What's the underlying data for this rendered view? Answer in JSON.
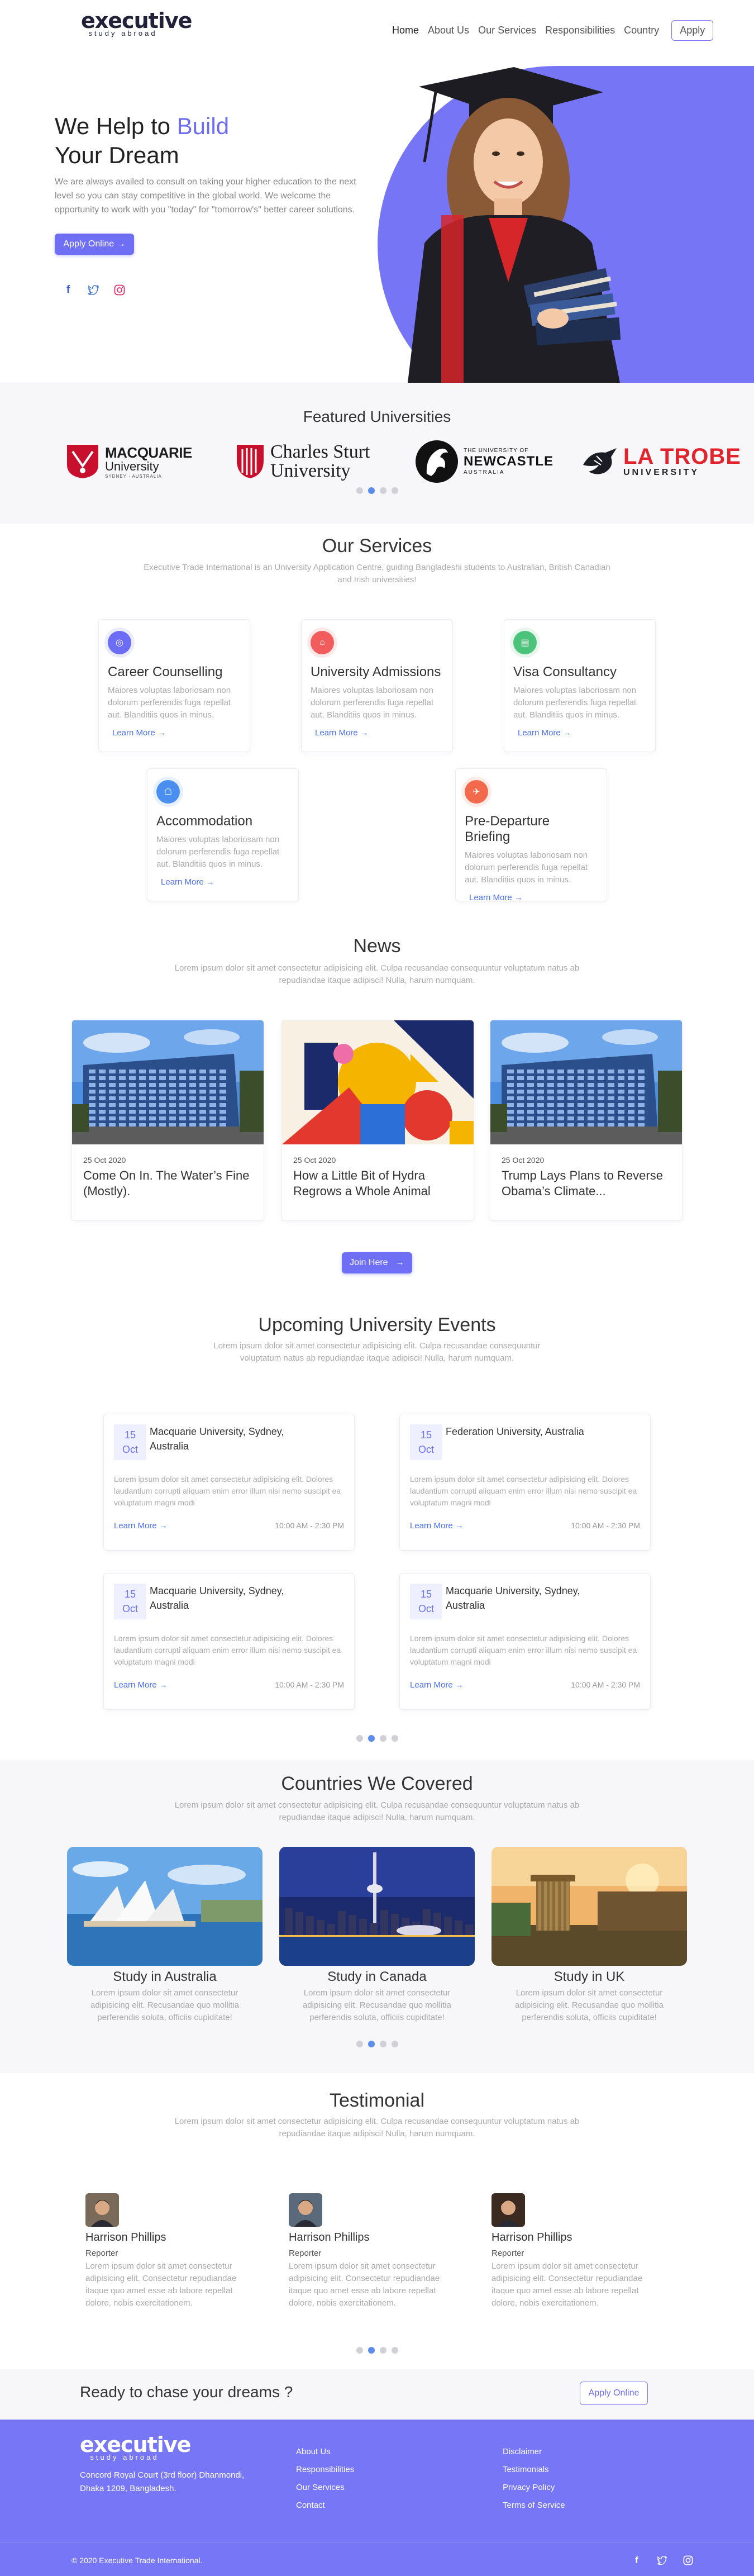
{
  "brand": {
    "name": "executive",
    "tagline": "study abroad"
  },
  "nav": {
    "items": [
      "Home",
      "About Us",
      "Our Services",
      "Responsibilities",
      "Country"
    ],
    "apply": "Apply"
  },
  "hero": {
    "title_part1": "We Help to",
    "title_accent": "Build",
    "title_part2": "Your Dream",
    "text": "We are always availed to consult on taking your higher education to the next level so you can stay competitive in the global world. We welcome the opportunity to work with you \"today\" for \"tomorrow's\" better career solutions.",
    "cta": "Apply Online →"
  },
  "universities": {
    "title": "Featured Universities",
    "logos": [
      {
        "name": "MACQUARIE",
        "line2": "University",
        "line3": "SYDNEY · AUSTRALIA"
      },
      {
        "name": "Charles Sturt",
        "line2": "University"
      },
      {
        "name": "NEWCASTLE",
        "line1": "THE UNIVERSITY OF",
        "line3": "AUSTRALIA"
      },
      {
        "name": "LA TROBE",
        "line2": "UNIVERSITY"
      }
    ]
  },
  "services": {
    "title": "Our Services",
    "subtitle": "Executive Trade International is an University Application Centre, guiding Bangladeshi students to Australian, British Canadian and Irish universities!",
    "items": [
      {
        "title": "Career Counselling",
        "text": "Maiores voluptas laboriosam non dolorum perferendis fuga repellat aut. Blanditiis quos in minus.",
        "link": "Learn More →",
        "color": "#6c6cf5",
        "icon": "compass-icon"
      },
      {
        "title": "University Admissions",
        "text": "Maiores voluptas laboriosam non dolorum perferendis fuga repellat aut. Blanditiis quos in minus.",
        "link": "Learn More →",
        "color": "#f25c5c",
        "icon": "building-icon"
      },
      {
        "title": "Visa Consultancy",
        "text": "Maiores voluptas laboriosam non dolorum perferendis fuga repellat aut. Blanditiis quos in minus.",
        "link": "Learn More →",
        "color": "#4cc37a",
        "icon": "passport-icon"
      },
      {
        "title": "Accommodation",
        "text": "Maiores voluptas laboriosam non dolorum perferendis fuga repellat aut. Blanditiis quos in minus.",
        "link": "Learn More →",
        "color": "#4a8ff0",
        "icon": "home-icon"
      },
      {
        "title": "Pre-Departure Briefing",
        "text": "Maiores voluptas laboriosam non dolorum perferendis fuga repellat aut. Blanditiis quos in minus.",
        "link": "Learn More →",
        "color": "#f26a4b",
        "icon": "plane-icon"
      }
    ]
  },
  "news": {
    "title": "News",
    "subtitle": "Lorem ipsum dolor sit amet consectetur adipisicing elit. Culpa recusandae consequuntur voluptatum natus ab repudiandae itaque adipisci! Nulla, harum numquam.",
    "items": [
      {
        "date": "25 Oct 2020",
        "title": "Come On In. The Water’s Fine (Mostly).",
        "image": "building"
      },
      {
        "date": "25 Oct 2020",
        "title": "How a Little Bit of Hydra Regrows a Whole Animal",
        "image": "art"
      },
      {
        "date": "25 Oct 2020",
        "title": "Trump Lays Plans to Reverse Obama’s Climate...",
        "image": "building"
      }
    ],
    "join": "Join Here   →"
  },
  "events": {
    "title": "Upcoming University Events",
    "subtitle": "Lorem ipsum dolor sit amet consectetur adipisicing elit. Culpa recusandae consequuntur voluptatum natus ab repudiandae itaque adipisci! Nulla, harum numquam.",
    "items": [
      {
        "day": "15",
        "month": "Oct",
        "title": "Macquarie University, Sydney, Australia",
        "text": "Lorem ipsum dolor sit amet consectetur adipisicing elit. Dolores laudantium corrupti aliquam enim error illum nisi nemo suscipit ea voluptatum magni modi",
        "link": "Learn More →",
        "time": "10:00 AM - 2:30 PM"
      },
      {
        "day": "15",
        "month": "Oct",
        "title": "Federation University, Australia",
        "text": "Lorem ipsum dolor sit amet consectetur adipisicing elit. Dolores laudantium corrupti aliquam enim error illum nisi nemo suscipit ea voluptatum magni modi",
        "link": "Learn More →",
        "time": "10:00 AM - 2:30 PM"
      },
      {
        "day": "15",
        "month": "Oct",
        "title": "Macquarie University, Sydney, Australia",
        "text": "Lorem ipsum dolor sit amet consectetur adipisicing elit. Dolores laudantium corrupti aliquam enim error illum nisi nemo suscipit ea voluptatum magni modi",
        "link": "Learn More →",
        "time": "10:00 AM - 2:30 PM"
      },
      {
        "day": "15",
        "month": "Oct",
        "title": "Macquarie University, Sydney, Australia",
        "text": "Lorem ipsum dolor sit amet consectetur adipisicing elit. Dolores laudantium corrupti aliquam enim error illum nisi nemo suscipit ea voluptatum magni modi",
        "link": "Learn More →",
        "time": "10:00 AM - 2:30 PM"
      }
    ]
  },
  "countries": {
    "title": "Countries We Covered",
    "subtitle": "Lorem ipsum dolor sit amet consectetur adipisicing elit. Culpa recusandae consequuntur voluptatum natus ab repudiandae itaque adipisci! Nulla, harum numquam.",
    "items": [
      {
        "name": "Study in Australia",
        "text": "Lorem ipsum dolor sit amet consectetur adipisicing elit. Recusandae quo mollitia perferendis soluta, officiis cupiditate!",
        "image": "sydney"
      },
      {
        "name": "Study in Canada",
        "text": "Lorem ipsum dolor sit amet consectetur adipisicing elit. Recusandae quo mollitia perferendis soluta, officiis cupiditate!",
        "image": "toronto"
      },
      {
        "name": "Study in UK",
        "text": "Lorem ipsum dolor sit amet consectetur adipisicing elit. Recusandae quo mollitia perferendis soluta, officiis cupiditate!",
        "image": "edinburgh"
      }
    ]
  },
  "testimonial": {
    "title": "Testimonial",
    "subtitle": "Lorem ipsum dolor sit amet consectetur adipisicing elit. Culpa recusandae consequuntur voluptatum natus ab repudiandae itaque adipisci! Nulla, harum numquam.",
    "items": [
      {
        "name": "Harrison Phillips",
        "role": "Reporter",
        "text": "Lorem ipsum dolor sit amet consectetur adipisicing elit. Consectetur repudiandae itaque quo amet esse ab labore repellat dolore, nobis exercitationem."
      },
      {
        "name": "Harrison Phillips",
        "role": "Reporter",
        "text": "Lorem ipsum dolor sit amet consectetur adipisicing elit. Consectetur repudiandae itaque quo amet esse ab labore repellat dolore, nobis exercitationem."
      },
      {
        "name": "Harrison Phillips",
        "role": "Reporter",
        "text": "Lorem ipsum dolor sit amet consectetur adipisicing elit. Consectetur repudiandae itaque quo amet esse ab labore repellat dolore, nobis exercitationem."
      }
    ]
  },
  "cta": {
    "text": "Ready to chase your dreams ?",
    "button": "Apply Online"
  },
  "footer": {
    "address": "Concord Royal Court (3rd floor) Dhanmondi, Dhaka 1209, Bangladesh.",
    "col1": [
      "About Us",
      "Responsibilities",
      "Our Services",
      "Contact"
    ],
    "col2": [
      "Disclaimer",
      "Testimonials",
      "Privacy Policy",
      "Terms of Service"
    ],
    "copyright": "© 2020 Executive Trade International."
  },
  "colors": {
    "accent": "#6f6ff5",
    "footer_bg": "#7676f6",
    "link": "#4b6ff2",
    "light_bg": "#f7f7f9"
  }
}
